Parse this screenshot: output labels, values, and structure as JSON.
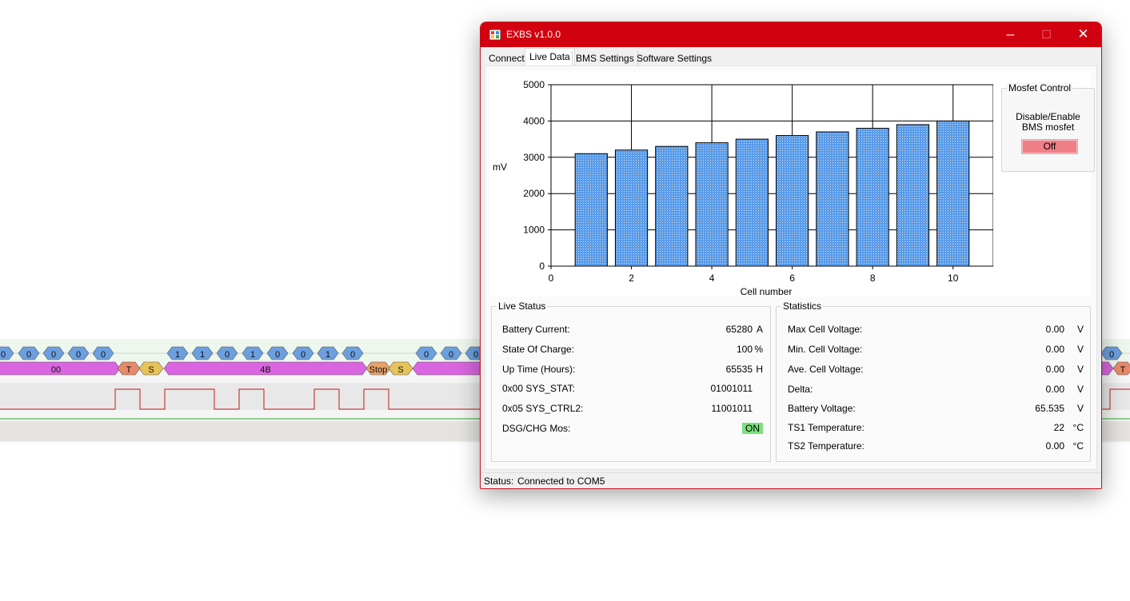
{
  "background": {
    "row1_bits_left": [
      "0",
      "0",
      "0",
      "0",
      "0"
    ],
    "row1_bits_mid": [
      "1",
      "1",
      "0",
      "1",
      "0",
      "0",
      "1",
      "0"
    ],
    "row1_bits_right": [
      "0",
      "0",
      "0"
    ],
    "row2_labels": {
      "byte1": "00",
      "t": "T",
      "s1": "S",
      "byte2": "4B",
      "stop": "Stop",
      "s2": "S",
      "t_right": "T"
    },
    "colors": {
      "bit": "#6b9fe0",
      "byte": "#d966e0",
      "t": "#e68a6a",
      "s": "#e6c45a",
      "stop": "#e6a36a"
    }
  },
  "window": {
    "title": "EXBS v1.0.0",
    "controls": {
      "minimize": "─",
      "maximize": "☐",
      "close": "✕"
    },
    "accent_color": "#d2010f"
  },
  "tabs": [
    {
      "label": "Connect"
    },
    {
      "label": "Live Data"
    },
    {
      "label": "BMS Settings"
    },
    {
      "label": "Software Settings"
    }
  ],
  "chart_data": {
    "type": "bar",
    "x": [
      1,
      2,
      3,
      4,
      5,
      6,
      7,
      8,
      9,
      10
    ],
    "values": [
      3100,
      3200,
      3300,
      3400,
      3500,
      3600,
      3700,
      3800,
      3900,
      4000
    ],
    "xlabel": "Cell number",
    "ylabel": "mV",
    "xlim": [
      0,
      11
    ],
    "ylim": [
      0,
      5000
    ],
    "x_ticks": [
      "0",
      "2",
      "4",
      "6",
      "8",
      "10"
    ],
    "y_ticks": [
      "0",
      "1000",
      "2000",
      "3000",
      "4000",
      "5000"
    ],
    "grid": true,
    "bar_color": "#5a9be8"
  },
  "mosfet": {
    "group_title": "Mosfet Control",
    "description_line1": "Disable/Enable",
    "description_line2": "BMS mosfet",
    "button_label": "Off"
  },
  "live_status": {
    "title": "Live Status",
    "rows": [
      {
        "label": "Battery Current:",
        "value": "65280",
        "unit": "A"
      },
      {
        "label": "State Of Charge:",
        "value": "100",
        "unit": "%"
      },
      {
        "label": "Up Time (Hours):",
        "value": "65535",
        "unit": "H"
      },
      {
        "label": "0x00 SYS_STAT:",
        "value": "01001011",
        "unit": ""
      },
      {
        "label": "0x05 SYS_CTRL2:",
        "value": "11001011",
        "unit": ""
      },
      {
        "label": "DSG/CHG Mos:",
        "value": "ON",
        "unit": ""
      }
    ]
  },
  "statistics": {
    "title": "Statistics",
    "rows": [
      {
        "label": "Max Cell Voltage:",
        "value": "0.00",
        "unit": "V"
      },
      {
        "label": "Min. Cell Voltage:",
        "value": "0.00",
        "unit": "V"
      },
      {
        "label": "Ave. Cell Voltage:",
        "value": "0.00",
        "unit": "V"
      },
      {
        "label": "Delta:",
        "value": "0.00",
        "unit": "V"
      },
      {
        "label": "Battery Voltage:",
        "value": "65.535",
        "unit": "V"
      },
      {
        "label": "TS1 Temperature:",
        "value": "22",
        "unit": "°C"
      },
      {
        "label": "TS2 Temperature:",
        "value": "0.00",
        "unit": "°C"
      }
    ]
  },
  "status": {
    "label": "Status:",
    "value": "Connected to COM5"
  }
}
